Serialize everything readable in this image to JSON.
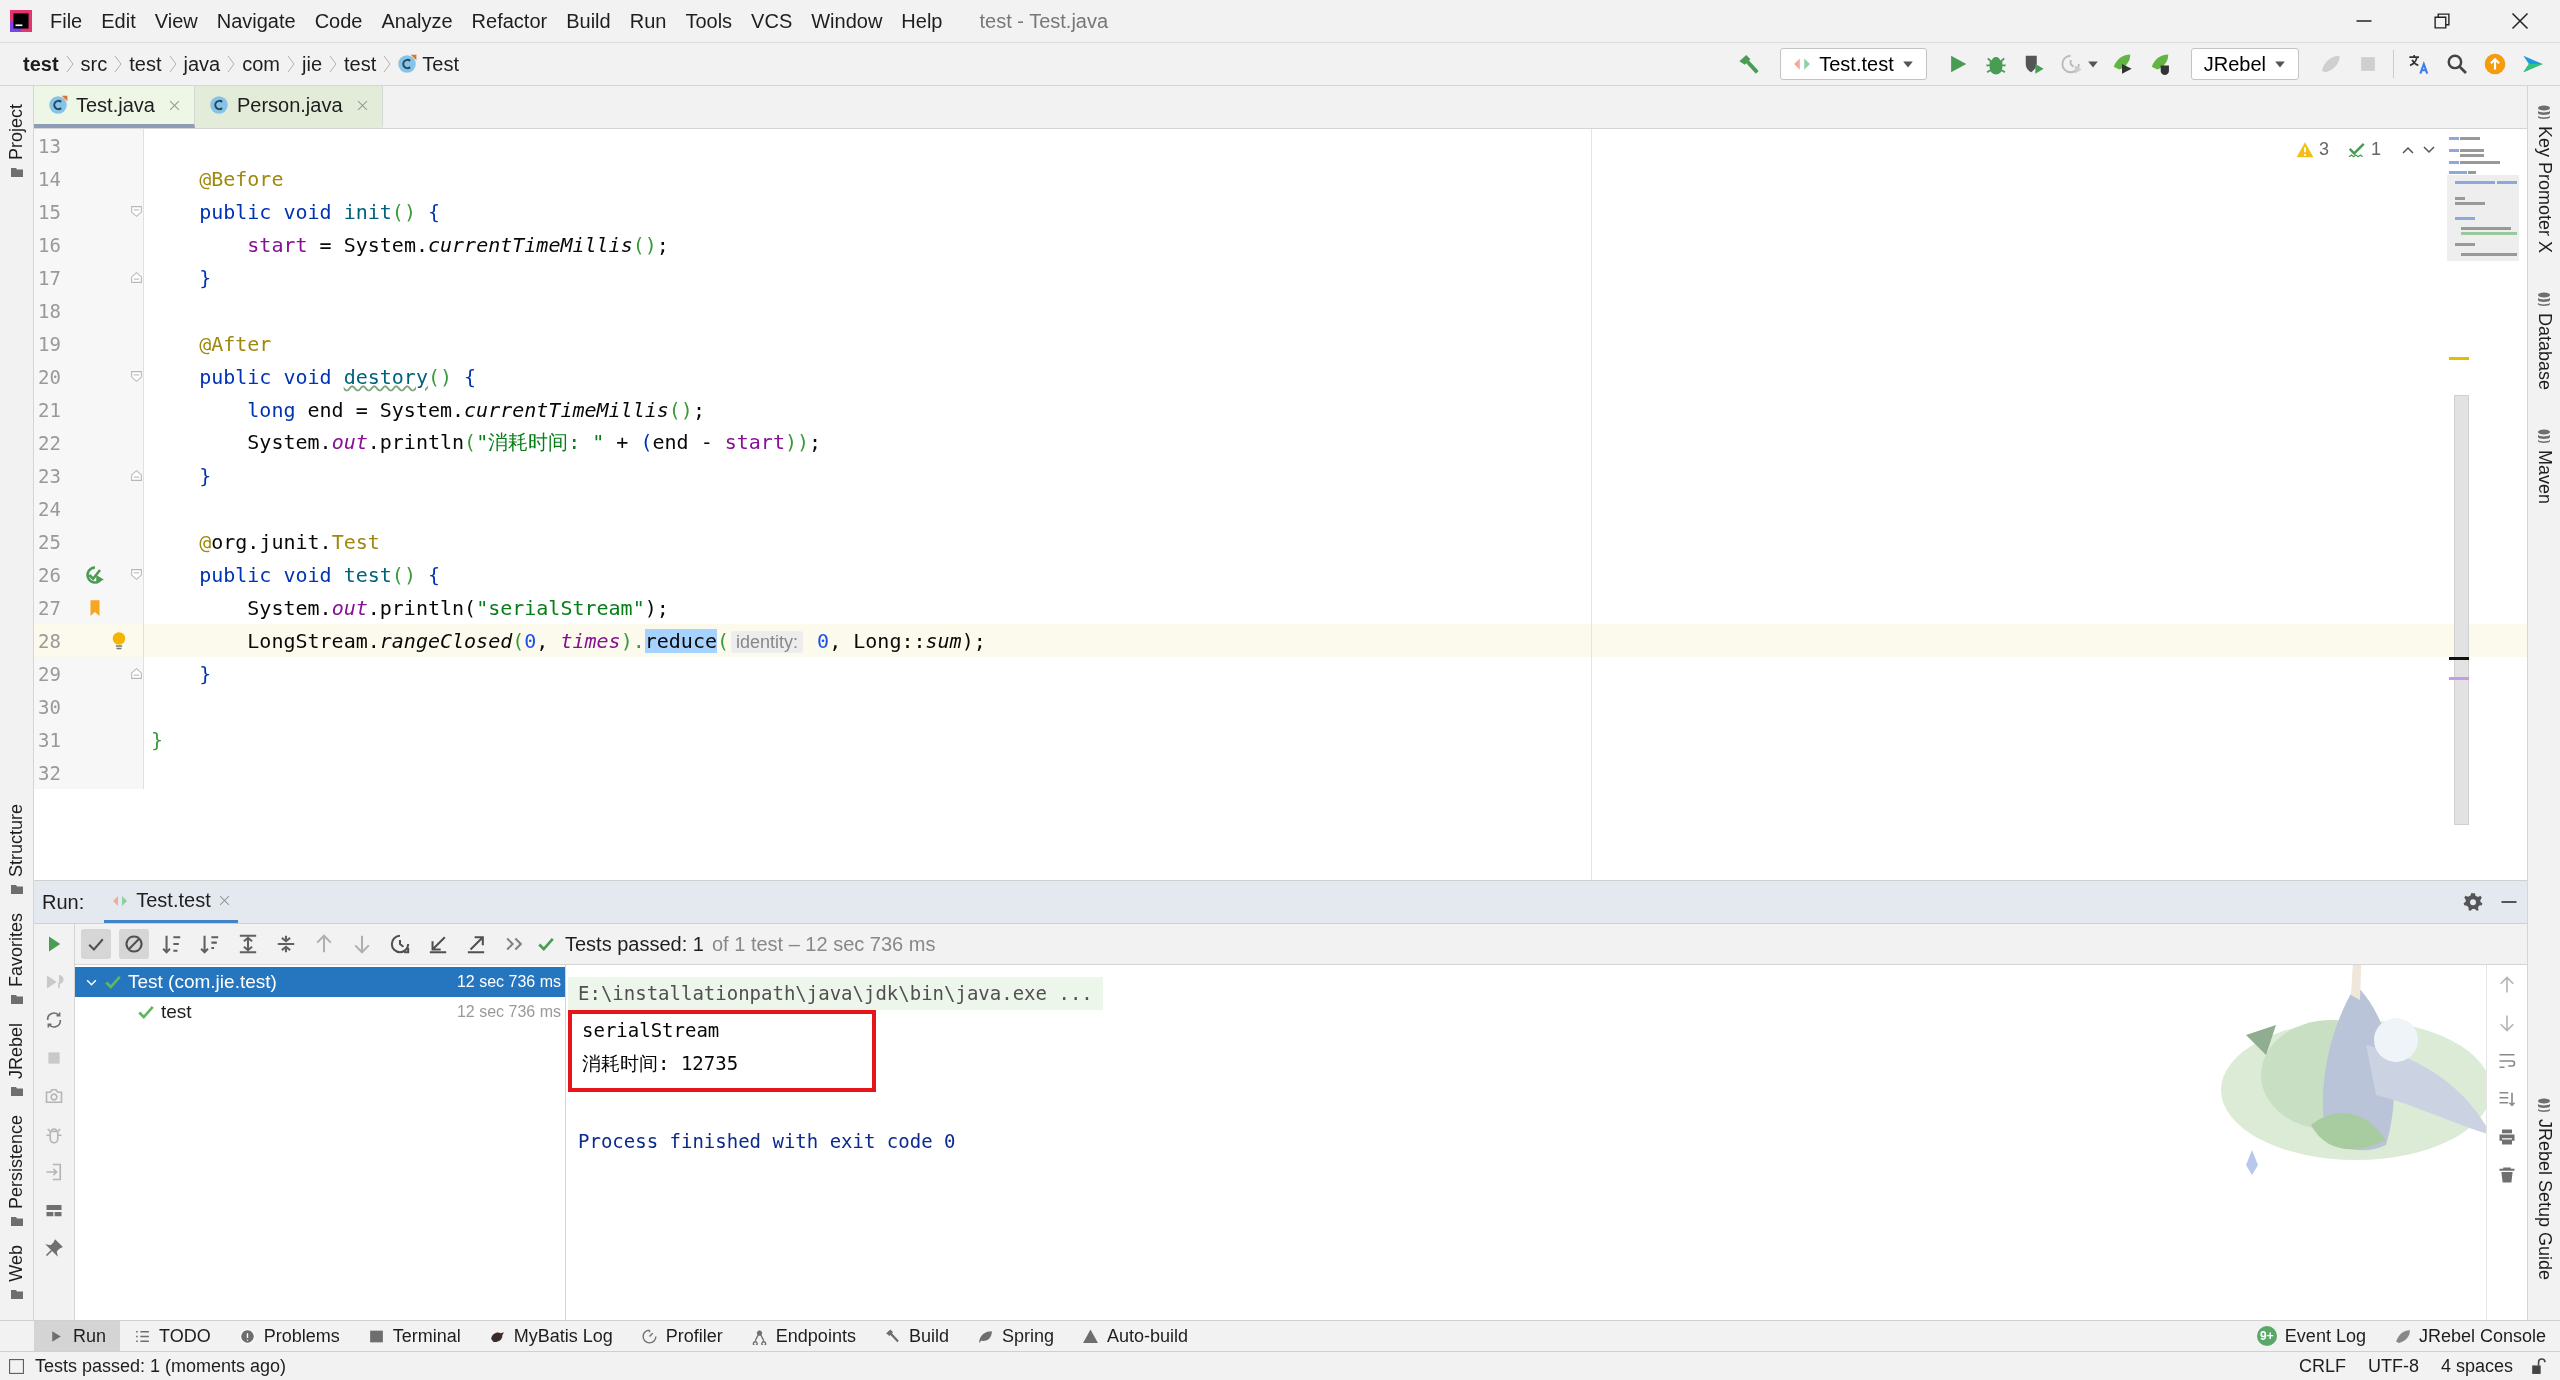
{
  "menu_bar": {
    "items": [
      "File",
      "Edit",
      "View",
      "Navigate",
      "Code",
      "Analyze",
      "Refactor",
      "Build",
      "Run",
      "Tools",
      "VCS",
      "Window",
      "Help"
    ],
    "title": "test - Test.java"
  },
  "breadcrumbs": [
    {
      "label": "test",
      "kind": "project"
    },
    {
      "label": "src",
      "kind": "folder"
    },
    {
      "label": "test",
      "kind": "folder"
    },
    {
      "label": "java",
      "kind": "folder"
    },
    {
      "label": "com",
      "kind": "folder"
    },
    {
      "label": "jie",
      "kind": "folder"
    },
    {
      "label": "test",
      "kind": "folder"
    },
    {
      "label": "Test",
      "kind": "class"
    }
  ],
  "toolbar": {
    "run_config": "Test.test",
    "jrebel_config": "JRebel"
  },
  "editor_tabs": [
    {
      "label": "Test.java",
      "selected": true
    },
    {
      "label": "Person.java",
      "selected": false
    }
  ],
  "inspections": {
    "warnings": "3",
    "checks": "1"
  },
  "code_lines": [
    {
      "number": "13",
      "current": false,
      "fold_start": false,
      "fold_end": false,
      "runnable": false,
      "bookmarked": false,
      "intention": false
    },
    {
      "number": "14",
      "current": false,
      "fold_start": false,
      "fold_end": false,
      "runnable": false,
      "bookmarked": false,
      "intention": false,
      "tokens": [
        {
          "text": "    @Before",
          "kind": "ann"
        }
      ]
    },
    {
      "number": "15",
      "current": false,
      "fold_start": true,
      "fold_end": false,
      "runnable": false,
      "bookmarked": false,
      "intention": false,
      "tokens": [
        {
          "text": "    public void",
          "kind": "kw"
        },
        {
          "text": " init",
          "kind": "method"
        },
        {
          "text": "()",
          "kind": "paren"
        },
        {
          "text": " {",
          "kind": "brace"
        }
      ]
    },
    {
      "number": "16",
      "current": false,
      "fold_start": false,
      "fold_end": false,
      "runnable": false,
      "bookmarked": false,
      "intention": false,
      "tokens": [
        {
          "text": "        start",
          "kind": "field"
        },
        {
          "text": " = System.",
          "kind": "plain"
        },
        {
          "text": "currentTimeMillis",
          "kind": "static"
        },
        {
          "text": "()",
          "kind": "paren"
        },
        {
          "text": ";",
          "kind": "plain"
        }
      ]
    },
    {
      "number": "17",
      "current": false,
      "fold_start": false,
      "fold_end": true,
      "runnable": false,
      "bookmarked": false,
      "intention": false,
      "tokens": [
        {
          "text": "    }",
          "kind": "brace"
        }
      ]
    },
    {
      "number": "18",
      "current": false,
      "fold_start": false,
      "fold_end": false,
      "runnable": false,
      "bookmarked": false,
      "intention": false
    },
    {
      "number": "19",
      "current": false,
      "fold_start": false,
      "fold_end": false,
      "runnable": false,
      "bookmarked": false,
      "intention": false,
      "tokens": [
        {
          "text": "    @After",
          "kind": "ann"
        }
      ]
    },
    {
      "number": "20",
      "current": false,
      "fold_start": true,
      "fold_end": false,
      "runnable": false,
      "bookmarked": false,
      "intention": false,
      "tokens": [
        {
          "text": "    public void ",
          "kind": "kw"
        },
        {
          "text": "destory",
          "kind": "method_warn"
        },
        {
          "text": "()",
          "kind": "paren"
        },
        {
          "text": " {",
          "kind": "brace"
        }
      ]
    },
    {
      "number": "21",
      "current": false,
      "fold_start": false,
      "fold_end": false,
      "runnable": false,
      "bookmarked": false,
      "intention": false,
      "tokens": [
        {
          "text": "        long",
          "kind": "kw"
        },
        {
          "text": " end = System.",
          "kind": "plain"
        },
        {
          "text": "currentTimeMillis",
          "kind": "static"
        },
        {
          "text": "()",
          "kind": "paren"
        },
        {
          "text": ";",
          "kind": "plain"
        }
      ]
    },
    {
      "number": "22",
      "current": false,
      "fold_start": false,
      "fold_end": false,
      "runnable": false,
      "bookmarked": false,
      "intention": false,
      "tokens": [
        {
          "text": "        System.",
          "kind": "plain"
        },
        {
          "text": "out",
          "kind": "static_field"
        },
        {
          "text": ".println",
          "kind": "plain"
        },
        {
          "text": "(",
          "kind": "paren"
        },
        {
          "text": "\"消耗时间: \"",
          "kind": "str"
        },
        {
          "text": " + ",
          "kind": "plain"
        },
        {
          "text": "(",
          "kind": "brace"
        },
        {
          "text": "end - ",
          "kind": "plain"
        },
        {
          "text": "start",
          "kind": "field"
        },
        {
          "text": "))",
          "kind": "paren"
        },
        {
          "text": ";",
          "kind": "plain"
        }
      ]
    },
    {
      "number": "23",
      "current": false,
      "fold_start": false,
      "fold_end": true,
      "runnable": false,
      "bookmarked": false,
      "intention": false,
      "tokens": [
        {
          "text": "    }",
          "kind": "brace"
        }
      ]
    },
    {
      "number": "24",
      "current": false,
      "fold_start": false,
      "fold_end": false,
      "runnable": false,
      "bookmarked": false,
      "intention": false
    },
    {
      "number": "25",
      "current": false,
      "fold_start": false,
      "fold_end": false,
      "runnable": false,
      "bookmarked": false,
      "intention": false,
      "tokens": [
        {
          "text": "    @",
          "kind": "ann"
        },
        {
          "text": "org.junit.",
          "kind": "plain"
        },
        {
          "text": "Test",
          "kind": "ann"
        }
      ]
    },
    {
      "number": "26",
      "current": false,
      "fold_start": true,
      "fold_end": false,
      "runnable": true,
      "bookmarked": false,
      "intention": false,
      "tokens": [
        {
          "text": "    public void",
          "kind": "kw"
        },
        {
          "text": " test",
          "kind": "method"
        },
        {
          "text": "()",
          "kind": "paren"
        },
        {
          "text": " {",
          "kind": "brace"
        }
      ]
    },
    {
      "number": "27",
      "current": false,
      "fold_start": false,
      "fold_end": false,
      "runnable": false,
      "bookmarked": true,
      "intention": false,
      "tokens": [
        {
          "text": "        System.",
          "kind": "plain"
        },
        {
          "text": "out",
          "kind": "static_field"
        },
        {
          "text": ".println(",
          "kind": "plain"
        },
        {
          "text": "\"serialStream\"",
          "kind": "str"
        },
        {
          "text": ");",
          "kind": "plain"
        }
      ]
    },
    {
      "number": "28",
      "current": true,
      "fold_start": false,
      "fold_end": false,
      "runnable": false,
      "bookmarked": false,
      "intention": true,
      "tokens": [
        {
          "text": "        LongStream.",
          "kind": "plain"
        },
        {
          "text": "rangeClosed",
          "kind": "static"
        },
        {
          "text": "(",
          "kind": "paren"
        },
        {
          "text": "0",
          "kind": "num"
        },
        {
          "text": ", ",
          "kind": "plain"
        },
        {
          "text": "times",
          "kind": "static_field"
        },
        {
          "text": ").",
          "kind": "paren"
        },
        {
          "text": "reduce",
          "kind": "selected"
        },
        {
          "text": "(",
          "kind": "paren"
        },
        {
          "text": "identity:",
          "kind": "hint"
        },
        {
          "text": " 0",
          "kind": "num"
        },
        {
          "text": ", Long::",
          "kind": "plain"
        },
        {
          "text": "sum",
          "kind": "static"
        },
        {
          "text": ");",
          "kind": "plain"
        }
      ]
    },
    {
      "number": "29",
      "current": false,
      "fold_start": false,
      "fold_end": true,
      "runnable": false,
      "bookmarked": false,
      "intention": false,
      "tokens": [
        {
          "text": "    }",
          "kind": "brace"
        }
      ]
    },
    {
      "number": "30",
      "current": false,
      "fold_start": false,
      "fold_end": false,
      "runnable": false,
      "bookmarked": false,
      "intention": false
    },
    {
      "number": "31",
      "current": false,
      "fold_start": false,
      "fold_end": false,
      "runnable": false,
      "bookmarked": false,
      "intention": false,
      "tokens": [
        {
          "text": "}",
          "kind": "paren"
        }
      ]
    },
    {
      "number": "32",
      "current": false,
      "fold_start": false,
      "fold_end": false,
      "runnable": false,
      "bookmarked": false,
      "intention": false
    }
  ],
  "run_panel": {
    "label": "Run:",
    "tab": "Test.test",
    "summary": "Tests passed: 1",
    "summary_detail": "of 1 test – 12 sec 736 ms",
    "tree": [
      {
        "label": "Test (com.jie.test)",
        "time": "12 sec 736 ms",
        "selected": true,
        "expanded": true,
        "children": [
          {
            "label": "test",
            "time": "12 sec 736 ms",
            "selected": false
          }
        ]
      }
    ],
    "console": [
      {
        "text": "E:\\installationpath\\java\\jdk\\bin\\java.exe ...",
        "kind": "command",
        "boxed": false
      },
      {
        "text": "serialStream",
        "kind": "output",
        "boxed": true
      },
      {
        "text": "消耗时间: 12735",
        "kind": "output",
        "boxed": true
      },
      {
        "text": "Process finished with exit code 0",
        "kind": "system",
        "boxed": false
      }
    ]
  },
  "left_tools": {
    "top": [
      "Project"
    ],
    "bottom": [
      "Structure",
      "Favorites",
      "JRebel",
      "Persistence",
      "Web"
    ]
  },
  "right_tools": {
    "top": [
      "Key Promoter X",
      "Database",
      "Maven"
    ],
    "bottom": [
      "JRebel Setup Guide"
    ]
  },
  "bottom_tabs": [
    {
      "label": "Run",
      "selected": true
    },
    {
      "label": "TODO",
      "selected": false
    },
    {
      "label": "Problems",
      "selected": false
    },
    {
      "label": "Terminal",
      "selected": false
    },
    {
      "label": "MyBatis Log",
      "selected": false
    },
    {
      "label": "Profiler",
      "selected": false
    },
    {
      "label": "Endpoints",
      "selected": false
    },
    {
      "label": "Build",
      "selected": false
    },
    {
      "label": "Spring",
      "selected": false
    },
    {
      "label": "Auto-build",
      "selected": false
    }
  ],
  "bottom_right": [
    {
      "label": "Event Log",
      "badge": "9+"
    },
    {
      "label": "JRebel Console"
    }
  ],
  "status": {
    "message": "Tests passed: 1 (moments ago)",
    "items": [
      "CRLF",
      "UTF-8",
      "4 spaces"
    ]
  }
}
